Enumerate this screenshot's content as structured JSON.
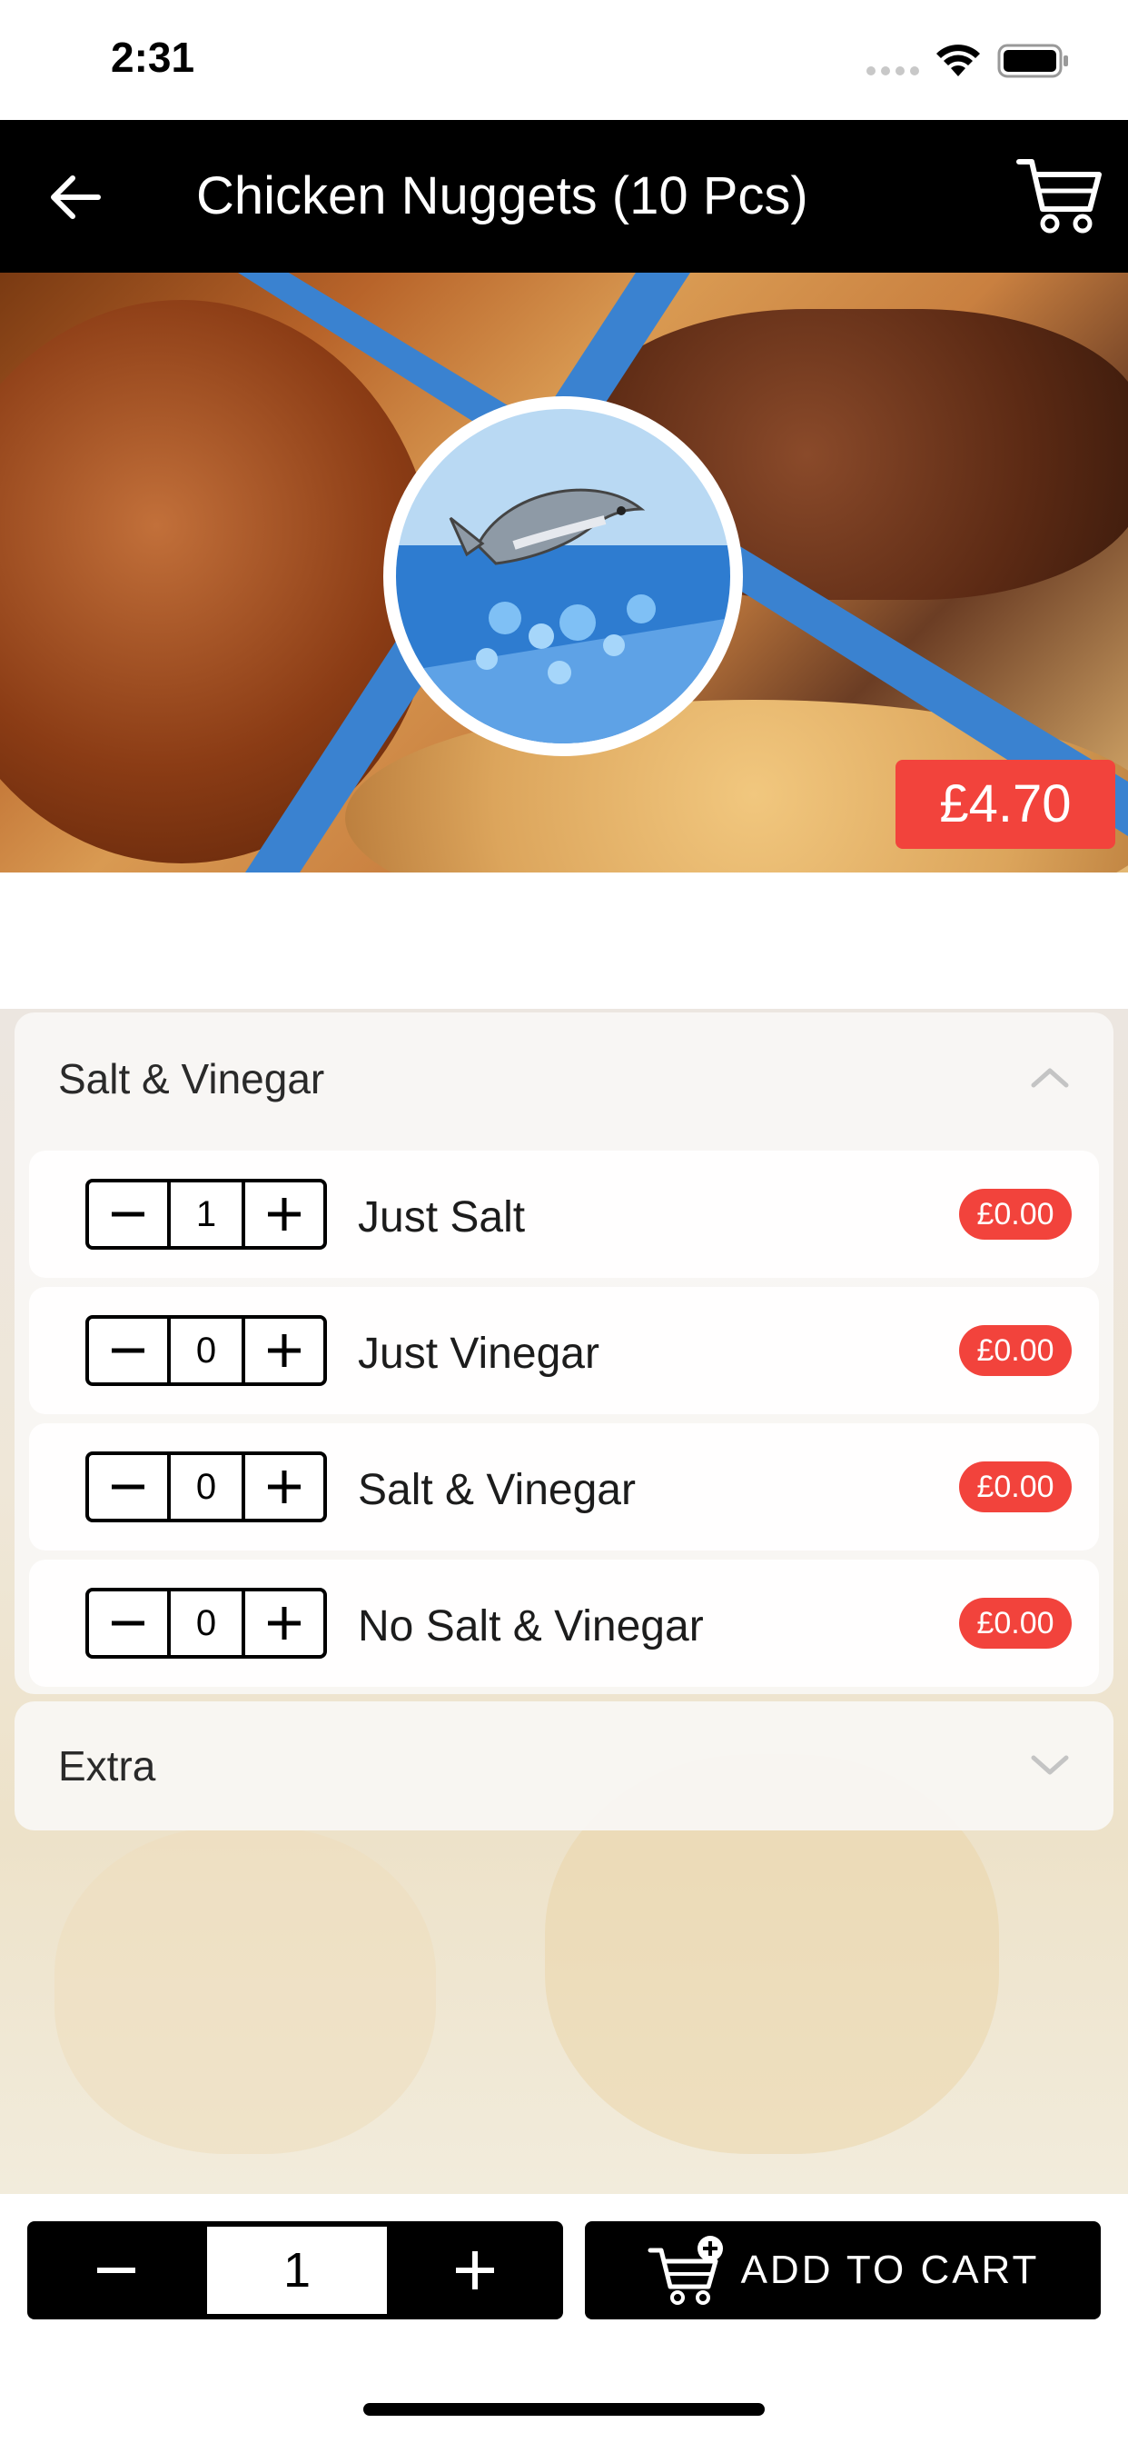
{
  "status_bar": {
    "time": "2:31"
  },
  "nav": {
    "title": "Chicken Nuggets (10 Pcs)"
  },
  "hero": {
    "price": "£4.70"
  },
  "sections": [
    {
      "title": "Salt & Vinegar",
      "expanded": true,
      "options": [
        {
          "label": "Just Salt",
          "qty": "1",
          "price": "£0.00"
        },
        {
          "label": "Just Vinegar",
          "qty": "0",
          "price": "£0.00"
        },
        {
          "label": "Salt & Vinegar",
          "qty": "0",
          "price": "£0.00"
        },
        {
          "label": "No Salt & Vinegar",
          "qty": "0",
          "price": "£0.00"
        }
      ]
    },
    {
      "title": "Extra",
      "expanded": false
    }
  ],
  "bottom_bar": {
    "quantity": "1",
    "add_to_cart_label": "ADD TO CART"
  },
  "colors": {
    "accent_red": "#f2433c",
    "nav_black": "#000000",
    "brand_blue": "#3a82d0"
  }
}
